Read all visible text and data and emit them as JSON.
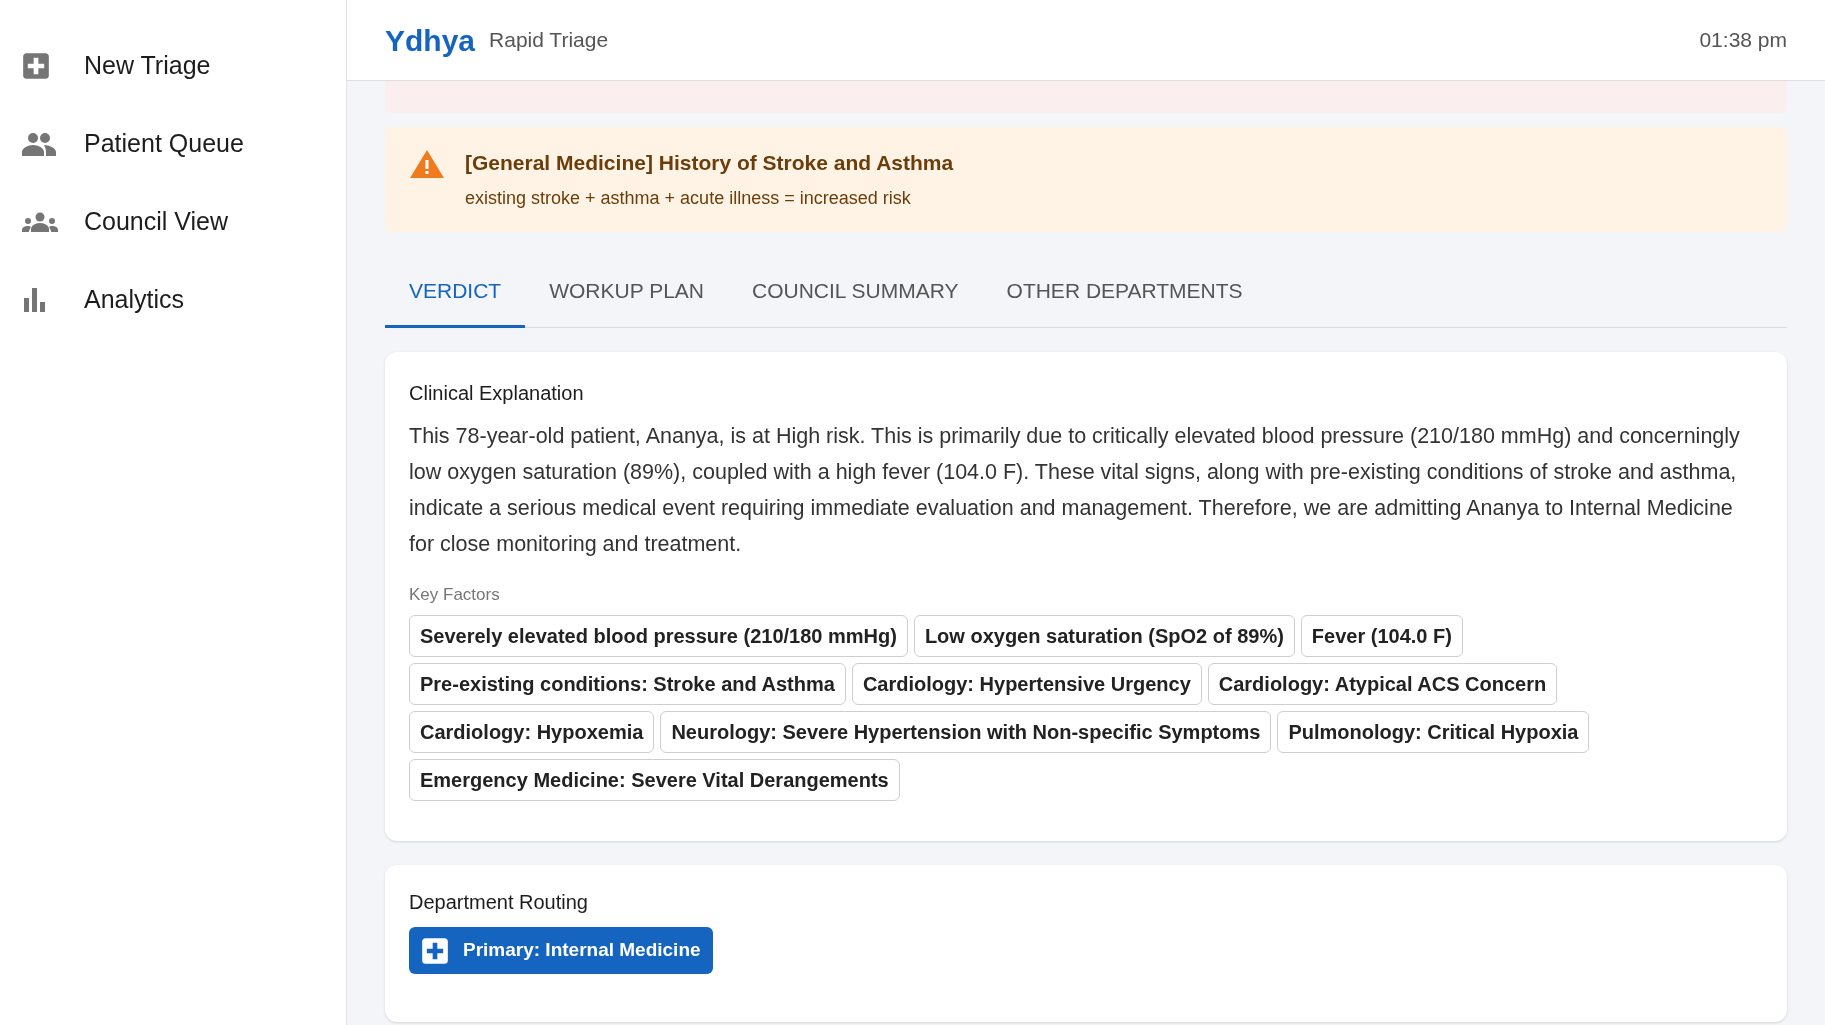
{
  "sidebar": {
    "items": [
      {
        "label": "New Triage"
      },
      {
        "label": "Patient Queue"
      },
      {
        "label": "Council View"
      },
      {
        "label": "Analytics"
      }
    ]
  },
  "header": {
    "brand": "Ydhya",
    "subtitle": "Rapid Triage",
    "time": "01:38 pm"
  },
  "alerts": [
    {
      "kind": "critical"
    },
    {
      "kind": "warning",
      "title": "[General Medicine] History of Stroke and Asthma",
      "detail": "existing stroke + asthma + acute illness = increased risk"
    }
  ],
  "tabs": [
    {
      "label": "VERDICT",
      "selected": true
    },
    {
      "label": "WORKUP PLAN",
      "selected": false
    },
    {
      "label": "COUNCIL SUMMARY",
      "selected": false
    },
    {
      "label": "OTHER DEPARTMENTS",
      "selected": false
    }
  ],
  "explanation": {
    "heading": "Clinical Explanation",
    "text": "This 78-year-old patient, Ananya, is at High risk. This is primarily due to critically elevated blood pressure (210/180 mmHg) and concerningly low oxygen saturation (89%), coupled with a high fever (104.0 F). These vital signs, along with pre-existing conditions of stroke and asthma, indicate a serious medical event requiring immediate evaluation and management. Therefore, we are admitting Ananya to Internal Medicine for close monitoring and treatment.",
    "factors_label": "Key Factors",
    "factors": [
      "Severely elevated blood pressure (210/180 mmHg)",
      "Low oxygen saturation (SpO2 of 89%)",
      "Fever (104.0 F)",
      "Pre-existing conditions: Stroke and Asthma",
      "Cardiology: Hypertensive Urgency",
      "Cardiology: Atypical ACS Concern",
      "Cardiology: Hypoxemia",
      "Neurology: Severe Hypertension with Non-specific Symptoms",
      "Pulmonology: Critical Hypoxia",
      "Emergency Medicine: Severe Vital Derangements"
    ]
  },
  "routing": {
    "heading": "Department Routing",
    "primary": "Primary: Internal Medicine"
  }
}
